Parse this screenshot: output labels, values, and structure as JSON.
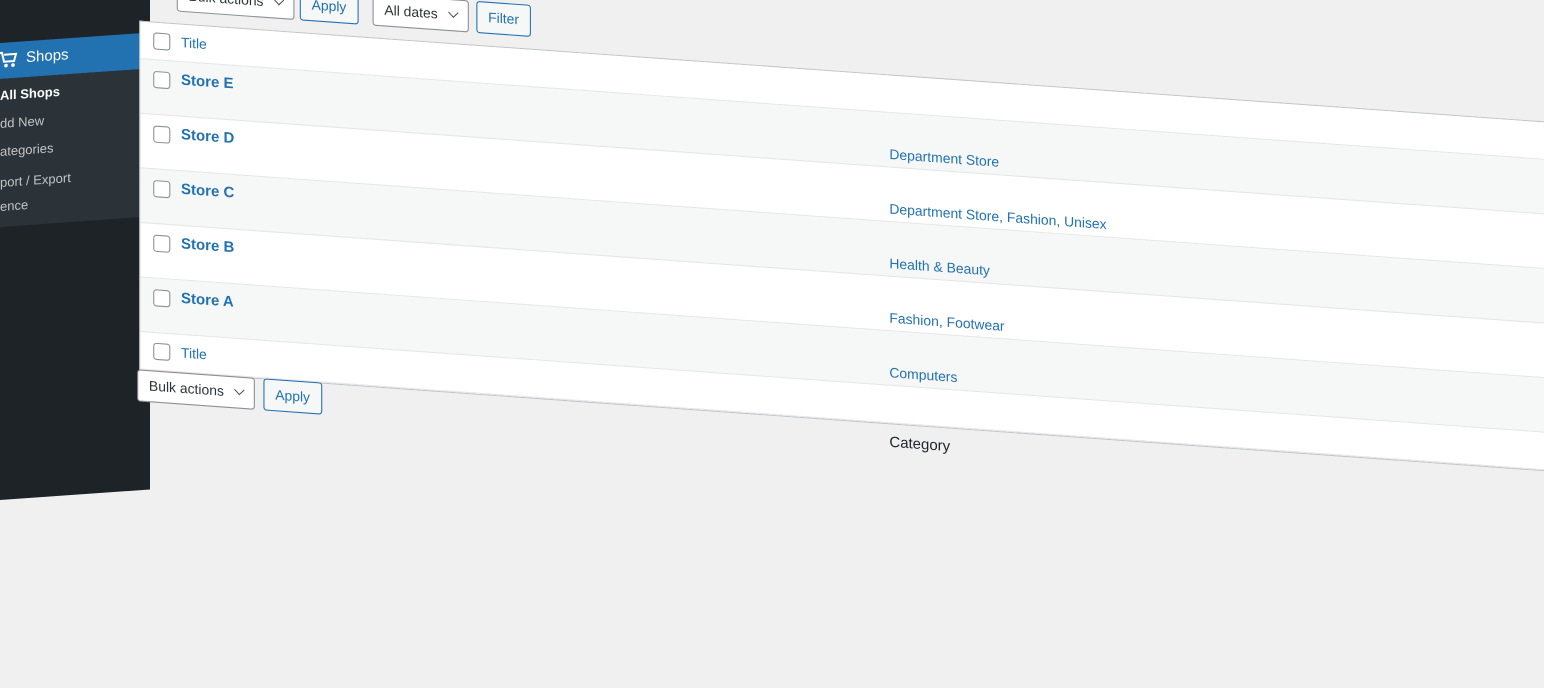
{
  "sidebar": {
    "menu_label": "Shops",
    "menu_icon": "cart-icon",
    "submenu": [
      {
        "label": "All Shops",
        "current": true
      },
      {
        "label": "dd New",
        "current": false
      },
      {
        "label": "ategories",
        "current": false
      },
      {
        "label": "port / Export",
        "current": false
      },
      {
        "label": "ence",
        "current": false
      }
    ]
  },
  "top_nav": {
    "bulk_actions": "Bulk actions",
    "apply": "Apply",
    "dates": "All dates",
    "filter": "Filter"
  },
  "table": {
    "columns": {
      "title": "Title",
      "category": "Category"
    },
    "rows": [
      {
        "title": "Store E",
        "category": "Department Store"
      },
      {
        "title": "Store D",
        "category": "Department Store, Fashion, Unisex"
      },
      {
        "title": "Store C",
        "category": "Health & Beauty"
      },
      {
        "title": "Store B",
        "category": "Fashion, Footwear"
      },
      {
        "title": "Store A",
        "category": "Computers"
      }
    ]
  },
  "bottom_nav": {
    "bulk_actions": "Bulk actions",
    "apply": "Apply"
  },
  "colors": {
    "accent": "#2271b1",
    "sidebar": "#1d2327"
  }
}
